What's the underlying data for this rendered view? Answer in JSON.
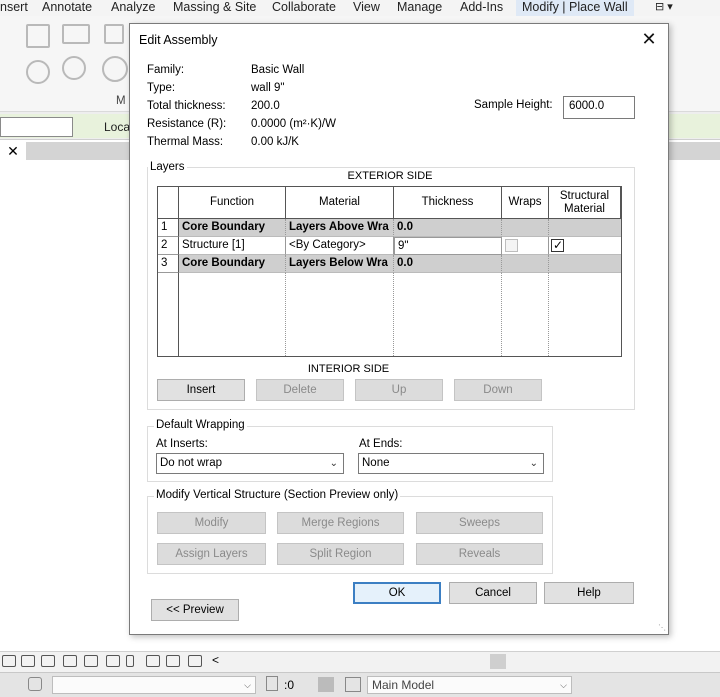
{
  "ribbon": {
    "tabs": [
      "nsert",
      "Annotate",
      "Analyze",
      "Massing & Site",
      "Collaborate",
      "View",
      "Manage",
      "Add-Ins",
      "Modify | Place Wall"
    ],
    "qat_symbol": "⊟ ▾",
    "panel_fragment": "M"
  },
  "options_bar": {
    "location_fragment": "Loca"
  },
  "view_tab": {
    "close_glyph": "✕"
  },
  "dialog": {
    "title": "Edit Assembly",
    "close_glyph": "✕",
    "properties": [
      {
        "label": "Family:",
        "value": "Basic Wall"
      },
      {
        "label": "Type:",
        "value": "wall 9\""
      },
      {
        "label": "Total thickness:",
        "value": "200.0"
      },
      {
        "label": "Resistance (R):",
        "value": "0.0000 (m²·K)/W"
      },
      {
        "label": "Thermal Mass:",
        "value": "0.00 kJ/K"
      }
    ],
    "sample_height": {
      "label": "Sample Height:",
      "value": "6000.0"
    },
    "layers": {
      "title": "Layers",
      "exterior_label": "EXTERIOR SIDE",
      "interior_label": "INTERIOR SIDE",
      "headers": {
        "function": "Function",
        "material": "Material",
        "thickness": "Thickness",
        "wraps": "Wraps",
        "structural": "Structural Material"
      },
      "rows": [
        {
          "num": "1",
          "function": "Core Boundary",
          "material": "Layers Above Wra",
          "thickness": "0.0"
        },
        {
          "num": "2",
          "function": "Structure [1]",
          "material": "<By Category>",
          "thickness": "9\""
        },
        {
          "num": "3",
          "function": "Core Boundary",
          "material": "Layers Below Wra",
          "thickness": "0.0"
        }
      ],
      "buttons": {
        "insert": "Insert",
        "delete": "Delete",
        "up": "Up",
        "down": "Down"
      }
    },
    "default_wrapping": {
      "title": "Default Wrapping",
      "at_inserts_label": "At Inserts:",
      "at_inserts_value": "Do not wrap",
      "at_ends_label": "At Ends:",
      "at_ends_value": "None"
    },
    "vertical_structure": {
      "title": "Modify Vertical Structure (Section Preview only)",
      "buttons": {
        "modify": "Modify",
        "merge": "Merge Regions",
        "sweeps": "Sweeps",
        "assign": "Assign Layers",
        "split": "Split Region",
        "reveals": "Reveals"
      }
    },
    "footer": {
      "ok": "OK",
      "cancel": "Cancel",
      "help": "Help",
      "preview": "<< Preview"
    }
  },
  "status_bar": {
    "back_arrow": "<",
    "filter_count": ":0",
    "model_value": "Main Model"
  }
}
